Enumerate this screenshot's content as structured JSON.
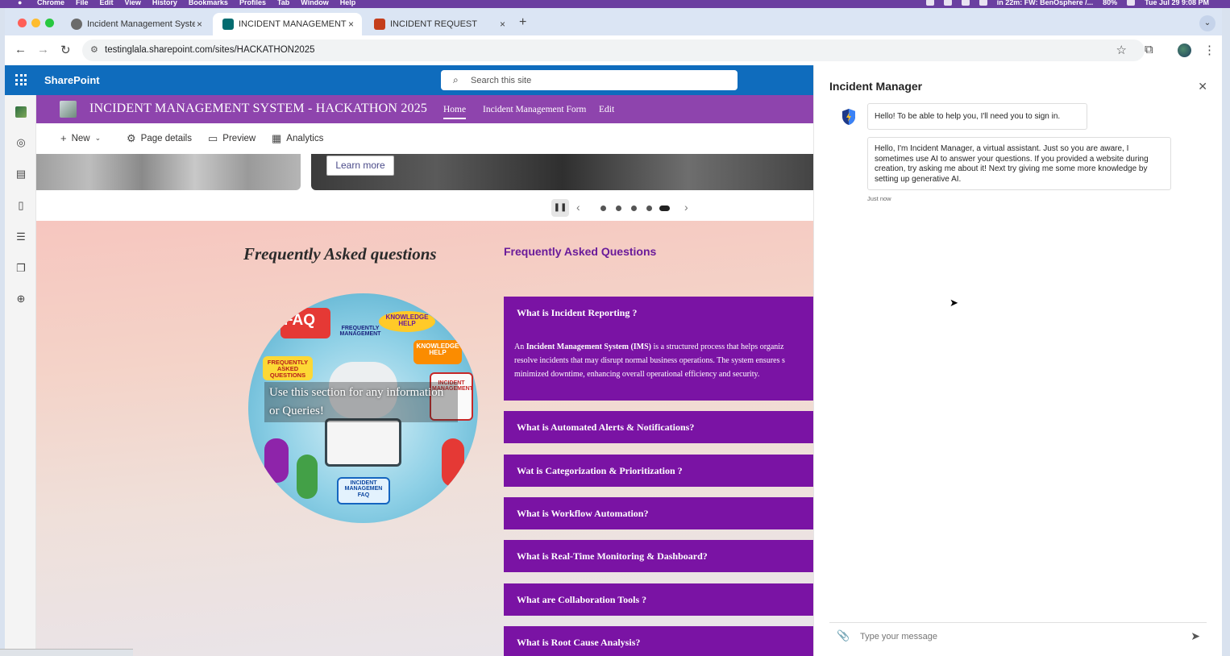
{
  "menubar": {
    "app": "Chrome",
    "items": [
      "File",
      "Edit",
      "View",
      "History",
      "Bookmarks",
      "Profiles",
      "Tab",
      "Window",
      "Help"
    ],
    "status_text": "in 22m: FW: BenOsphere /...",
    "battery": "80%",
    "datetime": "Tue Jul 29  9:08 PM"
  },
  "browser": {
    "tabs": [
      {
        "title": "Incident Management System",
        "color": "#6b6b6b"
      },
      {
        "title": "INCIDENT MANAGEMENT SYSTEM",
        "color": "#036c70"
      },
      {
        "title": "INCIDENT REQUEST",
        "color": "#c43e1c"
      }
    ],
    "close_glyph": "×",
    "new_tab_glyph": "+",
    "url": "testinglala.sharepoint.com/sites/HACKATHON2025"
  },
  "sharepoint": {
    "brand": "SharePoint",
    "search_placeholder": "Search this site",
    "site_title": "INCIDENT MANAGEMENT SYSTEM - HACKATHON 2025",
    "nav": [
      "Home",
      "Incident Management Form",
      "Edit"
    ],
    "commands": {
      "new": "New",
      "page_details": "Page details",
      "preview": "Preview",
      "analytics": "Analytics"
    },
    "hero": {
      "learn_more": "Learn more"
    }
  },
  "faq": {
    "heading_left": "Frequently Asked questions",
    "heading_right": "Frequently Asked Questions",
    "image_overlay": "Use this section for any information or Queries!",
    "image_labels": {
      "faq": "FAQ",
      "faq_alt": "FREQUENTLY MANAGEMENT",
      "knowledge": "KNOWLEDGE HELP",
      "knowledge_alt": "KNOWLEDGE HELP",
      "freq_asked": "FREQUENTLY ASKED QUESTIONS",
      "incident_mgmt": "INCIDENT MANAGEMENT",
      "incident_faq": "INCIDENT MANAGEMEN FAQ"
    },
    "items": [
      {
        "question": "What is Incident Reporting ?",
        "expanded": true
      },
      {
        "question": "What is Automated Alerts & Notifications?",
        "expanded": false
      },
      {
        "question": "Wat is Categorization & Prioritization ?",
        "expanded": false
      },
      {
        "question": "What is Workflow Automation?",
        "expanded": false
      },
      {
        "question": "What is Real-Time Monitoring & Dashboard?",
        "expanded": false
      },
      {
        "question": "What are Collaboration Tools ?",
        "expanded": false
      },
      {
        "question": "What is Root Cause Analysis?",
        "expanded": false
      }
    ],
    "answer": {
      "prefix": "An",
      "bold": "Incident Management System (IMS)",
      "line1": "is a structured process that helps organiz",
      "line2": "resolve incidents that may disrupt normal business operations. The system ensures s",
      "line3": "minimized downtime, enhancing overall operational efficiency and security."
    }
  },
  "chat": {
    "title": "Incident Manager",
    "messages": [
      "Hello! To be able to help you, I'll need you to sign in.",
      "Hello, I'm Incident Manager, a virtual assistant. Just so you are aware, I sometimes use AI to answer your questions. If you provided a website during creation, try asking me about it! Next try giving me some more knowledge by setting up generative AI."
    ],
    "timestamp": "Just now",
    "input_placeholder": "Type your message"
  },
  "colors": {
    "suite_blue": "#0f6cbd",
    "site_purple": "#8e44ad",
    "faq_purple": "#7a13a4",
    "menubar_purple": "#6b3fa0"
  }
}
